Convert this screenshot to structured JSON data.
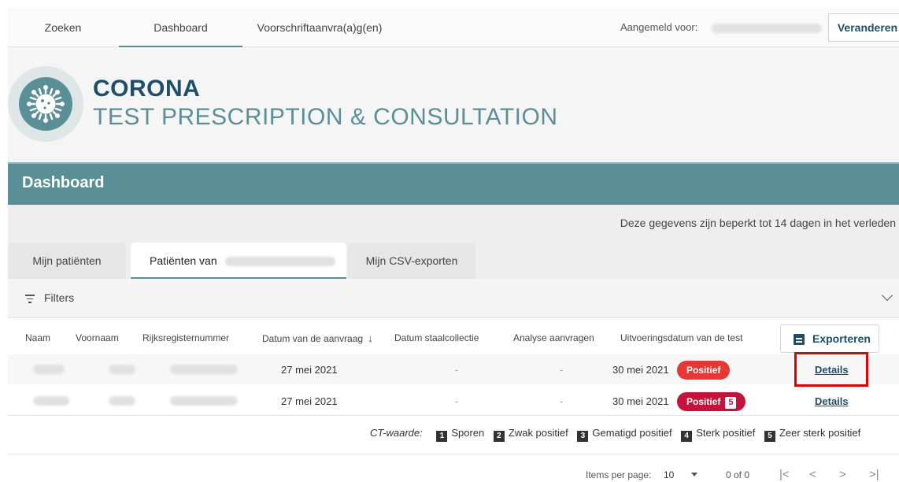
{
  "nav": {
    "tabs": [
      "Zoeken",
      "Dashboard",
      "Voorschriftaanvra(a)g(en)"
    ],
    "signed_in_label": "Aangemeld voor:",
    "change_button": "Veranderen"
  },
  "header": {
    "title_line1": "CORONA",
    "title_line2": "TEST PRESCRIPTION & CONSULTATION"
  },
  "dashboard": {
    "title": "Dashboard",
    "notice": "Deze gegevens zijn beperkt tot 14 dagen in het verleden"
  },
  "tabs": [
    "Mijn patiënten",
    "Patiënten van",
    "Mijn CSV-exporten"
  ],
  "filters": {
    "label": "Filters"
  },
  "table": {
    "columns": [
      "Naam",
      "Voornaam",
      "Rijksregisternummer",
      "Datum van de aanvraag",
      "Datum staalcollectie",
      "Analyse aanvragen",
      "Uitvoeringsdatum van de test"
    ],
    "export_button": "Exporteren",
    "rows": [
      {
        "request_date": "27 mei 2021",
        "sample_date": "-",
        "analysis": "-",
        "test_date": "30 mei 2021",
        "status": "Positief",
        "ct": "",
        "details": "Details"
      },
      {
        "request_date": "27 mei 2021",
        "sample_date": "-",
        "analysis": "-",
        "test_date": "30 mei 2021",
        "status": "Positief",
        "ct": "5",
        "details": "Details"
      }
    ]
  },
  "legend": {
    "label": "CT-waarde:",
    "items": [
      {
        "num": "1",
        "label": "Sporen"
      },
      {
        "num": "2",
        "label": "Zwak positief"
      },
      {
        "num": "3",
        "label": "Gematigd positief"
      },
      {
        "num": "4",
        "label": "Sterk positief"
      },
      {
        "num": "5",
        "label": "Zeer sterk positief"
      }
    ]
  },
  "pagination": {
    "items_label": "Items per page:",
    "page_size": "10",
    "count": "0 of 0"
  }
}
